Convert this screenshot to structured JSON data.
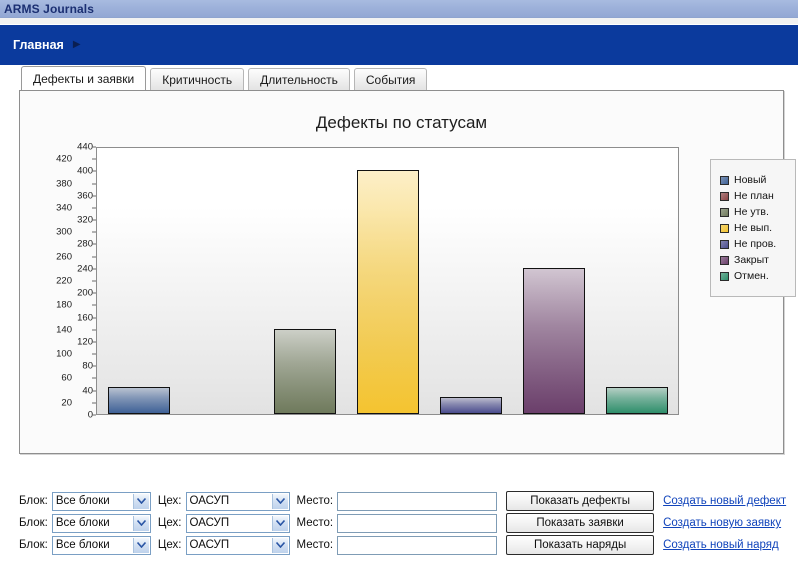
{
  "titlebar": {
    "app_title": "ARMS Journals"
  },
  "nav": {
    "breadcrumb": "Главная",
    "arrow": "▶"
  },
  "tabs": [
    {
      "label": "Дефекты и заявки",
      "active": true
    },
    {
      "label": "Критичность",
      "active": false
    },
    {
      "label": "Длительность",
      "active": false
    },
    {
      "label": "События",
      "active": false
    }
  ],
  "chart_data": {
    "type": "bar",
    "title": "Дефекты по статусам",
    "xlabel": "",
    "ylabel": "",
    "ylim": [
      0,
      440
    ],
    "ytick_step": 20,
    "grid": false,
    "legend_position": "right",
    "categories": [
      "Новый",
      "Не план",
      "Не утв.",
      "Не вып.",
      "Не пров.",
      "Закрыт",
      "Отмен."
    ],
    "values": [
      45,
      0,
      140,
      400,
      28,
      240,
      45
    ],
    "colors": [
      "#3f6197",
      "#8c4545",
      "#6f7a5c",
      "#f4c430",
      "#4b4d8e",
      "#6b3f6b",
      "#2f8f6b"
    ],
    "yticks": [
      440,
      420,
      400,
      380,
      360,
      340,
      320,
      300,
      280,
      260,
      240,
      220,
      200,
      180,
      160,
      140,
      120,
      100,
      80,
      60,
      40,
      20,
      0
    ],
    "legend": [
      {
        "label": "Новый",
        "color": "#3f6197"
      },
      {
        "label": "Не план",
        "color": "#8c4545"
      },
      {
        "label": "Не утв.",
        "color": "#6f7a5c"
      },
      {
        "label": "Не вып.",
        "color": "#f4c430"
      },
      {
        "label": "Не пров.",
        "color": "#4b4d8e"
      },
      {
        "label": "Закрыт",
        "color": "#6b3f6b"
      },
      {
        "label": "Отмен.",
        "color": "#2f8f6b"
      }
    ]
  },
  "form": {
    "block_label": "Блок:",
    "shop_label": "Цех:",
    "place_label": "Место:",
    "rows": [
      {
        "block_value": "Все блоки",
        "shop_value": "ОАСУП",
        "place_value": "",
        "place_placeholder": "",
        "button": "Показать дефекты",
        "link": "Создать новый дефект"
      },
      {
        "block_value": "Все блоки",
        "shop_value": "ОАСУП",
        "place_value": "",
        "place_placeholder": "",
        "button": "Показать заявки",
        "link": "Создать новую заявку"
      },
      {
        "block_value": "Все блоки",
        "shop_value": "ОАСУП",
        "place_value": "",
        "place_placeholder": "",
        "button": "Показать наряды",
        "link": "Создать новый наряд"
      }
    ]
  }
}
